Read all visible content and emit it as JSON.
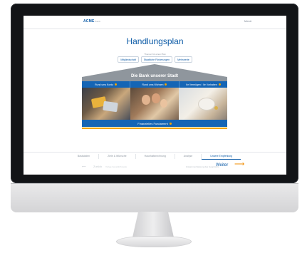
{
  "app": {
    "logo": "ACME",
    "logo_tag": "Bank",
    "menu": "Menü"
  },
  "page": {
    "title": "Handlungsplan",
    "subtitle": "Themen für einen Plan",
    "pills": [
      "Mitgliedschaft",
      "Staatliche Förderungen",
      "Mehrwerte"
    ]
  },
  "house": {
    "roof_label": "Die Bank unserer Stadt",
    "columns": [
      "Rund ums Konto",
      "Rund ums Wohnen",
      "Ihr Vermögen / Ihr Vorhaben"
    ],
    "foundation": "Finanzielles Fundament"
  },
  "bottom_nav": {
    "tabs": [
      "Basisdaten",
      "Ziele & Wünsche",
      "Haushaltsrechnung",
      "Analyse",
      "Unsere Empfehlung"
    ],
    "active_index": 4
  },
  "footer": {
    "back_label": "Zurück",
    "prev_page": "Vorige Gesprächsseite",
    "next_page": "Zusammenfassung des Gesprächs",
    "next_label": "Weiter",
    "arrow": "⟶"
  },
  "colors": {
    "brand_blue": "#1565b5",
    "accent_orange": "#f2a400",
    "roof_gray": "#8f969d"
  }
}
